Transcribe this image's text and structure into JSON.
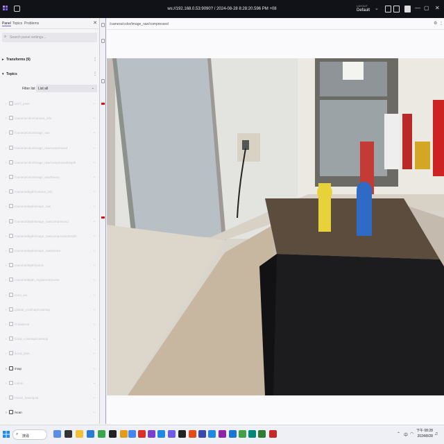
{
  "window": {
    "title": "ws://192.168.0.53:9090? / 2024-08-28 8:28:20.596 PM +08",
    "layout_label": "LAYOUT",
    "layout_value": "Default"
  },
  "sidebar": {
    "tabs": [
      {
        "label": "Panel",
        "active": true
      },
      {
        "label": "Topics",
        "active": false
      },
      {
        "label": "Problems",
        "active": false
      }
    ],
    "search_placeholder": "Search panel settings...",
    "transforms_label": "Transforms (9)",
    "topics_label": "Topics",
    "filter_label": "Filter list",
    "filter_value": "List all",
    "topic_items": [
      {
        "label": "amcl_pose",
        "dark": false
      },
      {
        "label": "/camera/color/camera_info",
        "dark": false
      },
      {
        "label": "/camera/color/image_raw",
        "dark": false
      },
      {
        "label": "/camera/color/image_raw/compressed",
        "dark": false
      },
      {
        "label": "/camera/color/image_raw/compressedDepth",
        "dark": false
      },
      {
        "label": "/camera/color/image_raw/theora",
        "dark": false
      },
      {
        "label": "/camera/depth/camera_info",
        "dark": false
      },
      {
        "label": "/camera/depth/image_raw",
        "dark": false
      },
      {
        "label": "/camera/depth/image_raw/compressed",
        "dark": false
      },
      {
        "label": "/camera/depth/image_raw/compressedDepth",
        "dark": false
      },
      {
        "label": "/camera/depth/image_raw/theora",
        "dark": false
      },
      {
        "label": "/camera/depth/points",
        "dark": false
      },
      {
        "label": "/camera/depth_registered/points",
        "dark": false
      },
      {
        "label": "/cmd_vel",
        "dark": false
      },
      {
        "label": "/global_costmap/costmap",
        "dark": false
      },
      {
        "label": "/initialpose",
        "dark": false
      },
      {
        "label": "/local_costmap/costmap",
        "dark": false
      },
      {
        "label": "/local_plan",
        "dark": false
      },
      {
        "label": "/map",
        "dark": true
      },
      {
        "label": "/odom",
        "dark": false
      },
      {
        "label": "/move_base/goal",
        "dark": false
      },
      {
        "label": "/scan",
        "dark": true
      }
    ]
  },
  "panel": {
    "topic_title": "/camera/color/image_raw/compressed"
  },
  "taskbar": {
    "search_label": "搜尋",
    "time": "下午 08:28",
    "date": "2024/8/28",
    "lang": "中"
  },
  "colors": {
    "titlebar_bg": "#111218",
    "accent": "#6c5ce7"
  }
}
